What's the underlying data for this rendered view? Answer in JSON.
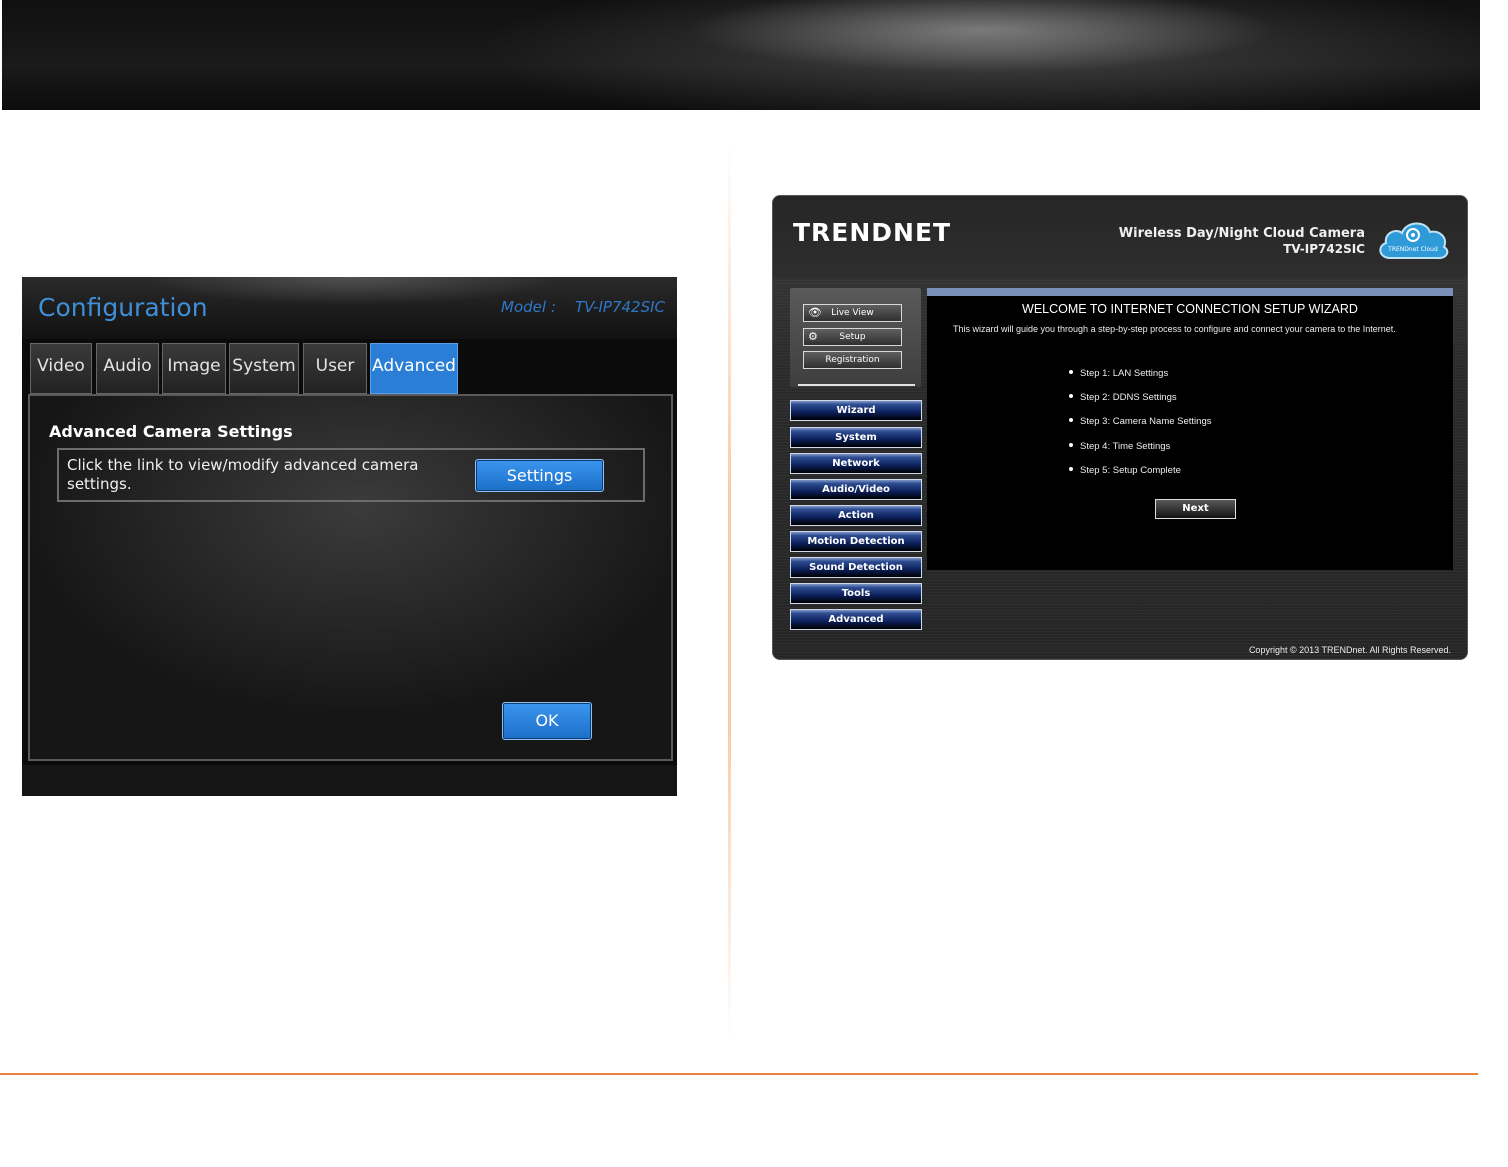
{
  "config_dialog": {
    "title": "Configuration",
    "model": "Model :    TV-IP742SIC",
    "tabs": [
      {
        "label": "Video"
      },
      {
        "label": "Audio"
      },
      {
        "label": "Image"
      },
      {
        "label": "System"
      },
      {
        "label": "User"
      },
      {
        "label": "Advanced",
        "active": true
      }
    ],
    "section_title": "Advanced Camera Settings",
    "description": "Click the link to view/modify advanced camera settings.",
    "settings_button": "Settings",
    "ok_button": "OK"
  },
  "web_ui": {
    "logo_text": "TRENDNET",
    "product_name": "Wireless Day/Night Cloud Camera",
    "product_model": "TV-IP742SIC",
    "cloud_badge": "TRENDnet Cloud",
    "side_buttons": [
      {
        "label": "Live View",
        "icon": "eye-icon"
      },
      {
        "label": "Setup",
        "icon": "gear-icon"
      },
      {
        "label": "Registration",
        "icon": ""
      }
    ],
    "nav": [
      {
        "label": "Wizard"
      },
      {
        "label": "System"
      },
      {
        "label": "Network"
      },
      {
        "label": "Audio/Video"
      },
      {
        "label": "Action"
      },
      {
        "label": "Motion Detection"
      },
      {
        "label": "Sound Detection"
      },
      {
        "label": "Tools"
      },
      {
        "label": "Advanced"
      }
    ],
    "wizard": {
      "title": "WELCOME TO INTERNET CONNECTION SETUP WIZARD",
      "description": "This wizard will guide you through a step-by-step process to configure and connect your camera to the Internet.",
      "steps": [
        "Step 1: LAN Settings",
        "Step 2: DDNS Settings",
        "Step 3: Camera Name Settings",
        "Step 4: Time Settings",
        "Step 5: Setup Complete"
      ],
      "next_button": "Next"
    },
    "copyright": "Copyright © 2013 TRENDnet. All Rights Reserved."
  },
  "colors": {
    "accent_blue": "#2a7ed6",
    "orange_rule": "#e8823c",
    "nav_blue": "#0b1f5a"
  }
}
